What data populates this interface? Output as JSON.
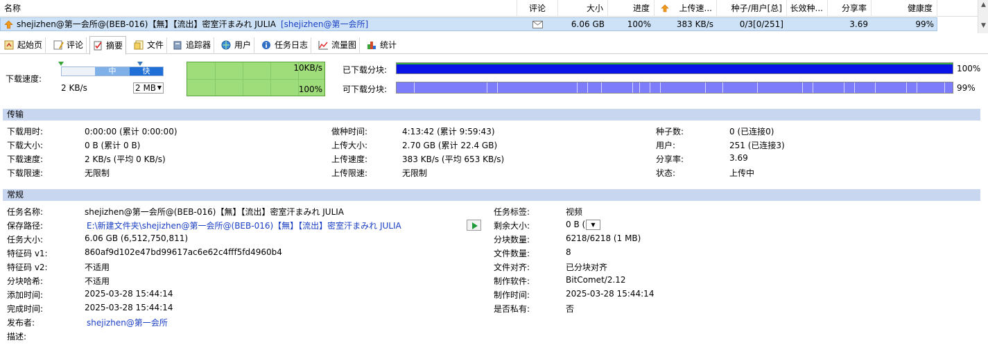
{
  "list": {
    "columns": [
      "名称",
      "评论",
      "大小",
      "进度",
      "上传速...",
      "种子/用户[总]",
      "长效种...",
      "分享率",
      "健康度"
    ],
    "row": {
      "name": "shejizhen@第一会所@(BEB-016)【無】【流出】密室汗まみれ JULIA",
      "publisher_tag": "[shejizhen@第一会所]",
      "size": "6.06 GB",
      "progress": "100%",
      "upload_speed": "383 KB/s",
      "seeds_peers": "0/3[0/251]",
      "ratio": "3.69",
      "health": "99%"
    }
  },
  "tabs": [
    {
      "label": "起始页",
      "icon": "home-page-icon"
    },
    {
      "label": "评论",
      "icon": "comment-icon"
    },
    {
      "label": "摘要",
      "icon": "summary-icon",
      "active": true
    },
    {
      "label": "文件",
      "icon": "file-icon"
    },
    {
      "label": "追踪器",
      "icon": "tracker-icon"
    },
    {
      "label": "用户",
      "icon": "peers-icon"
    },
    {
      "label": "任务日志",
      "icon": "info-log-icon"
    },
    {
      "label": "流量图",
      "icon": "traffic-chart-icon"
    },
    {
      "label": "统计",
      "icon": "statistics-icon"
    }
  ],
  "speed": {
    "label": "下载速度:",
    "value": "2 KB/s",
    "slider_mid": "中",
    "slider_fast": "快",
    "block_size": "2 MB",
    "graph_top": "10KB/s",
    "graph_bottom": "100%"
  },
  "pieces": {
    "downloaded_label": "已下载分块:",
    "downloaded_pct": "100%",
    "downloaded_fraction": 1.0,
    "available_label": "可下载分块:",
    "available_pct": "99%",
    "available_fraction": 0.99
  },
  "transfer": {
    "header": "传输",
    "col1": [
      {
        "label": "下载用时:",
        "value": "0:00:00 (累计 0:00:00)"
      },
      {
        "label": "下载大小:",
        "value": "0 B (累计 0 B)"
      },
      {
        "label": "下载速度:",
        "value": "2 KB/s (平均 0 KB/s)"
      },
      {
        "label": "下载限速:",
        "value": "无限制"
      }
    ],
    "col2": [
      {
        "label": "做种时间:",
        "value": "4:13:42 (累计 9:59:43)"
      },
      {
        "label": "上传大小:",
        "value": "2.70 GB (累计 22.4 GB)"
      },
      {
        "label": "上传速度:",
        "value": "383 KB/s (平均 653 KB/s)"
      },
      {
        "label": "上传限速:",
        "value": "无限制"
      }
    ],
    "col3": [
      {
        "label": "种子数:",
        "value": "0 (已连接0)"
      },
      {
        "label": "用户:",
        "value": "251 (已连接3)"
      },
      {
        "label": "分享率:",
        "value": "3.69"
      },
      {
        "label": "状态:",
        "value": "上传中"
      }
    ]
  },
  "general": {
    "header": "常规",
    "col1": [
      {
        "label": "任务名称:",
        "value": "shejizhen@第一会所@(BEB-016)【無】【流出】密室汗まみれ JULIA"
      },
      {
        "label": "保存路径:",
        "value": "E:\\新建文件夹\\shejizhen@第一会所@(BEB-016)【無】【流出】密室汗まみれ JULIA",
        "link": true
      },
      {
        "label": "任务大小:",
        "value": "6.06 GB (6,512,750,811)"
      },
      {
        "label": "特征码 v1:",
        "value": "860af9d102e47bd99617ac6e62c4fff5fd4960b4"
      },
      {
        "label": "特征码 v2:",
        "value": "不适用"
      },
      {
        "label": "分块哈希:",
        "value": "不适用"
      },
      {
        "label": "添加时间:",
        "value": "2025-03-28 15:44:14"
      },
      {
        "label": "完成时间:",
        "value": "2025-03-28 15:44:14"
      },
      {
        "label": "发布者:",
        "value": "shejizhen@第一会所",
        "link": true
      },
      {
        "label": "描述:",
        "value": ""
      }
    ],
    "col2": [
      {
        "label": "任务标签:",
        "value": "视频"
      },
      {
        "label": "剩余大小:",
        "value": "0 B (0)"
      },
      {
        "label": "分块数量:",
        "value": "6218/6218 (1 MB)"
      },
      {
        "label": "文件数量:",
        "value": "8"
      },
      {
        "label": "文件对齐:",
        "value": "已分块对齐"
      },
      {
        "label": "制作软件:",
        "value": "BitComet/2.12"
      },
      {
        "label": "制作时间:",
        "value": "2025-03-28 15:44:14"
      },
      {
        "label": "是否私有:",
        "value": "否"
      }
    ]
  }
}
